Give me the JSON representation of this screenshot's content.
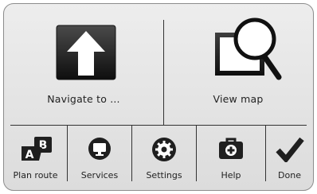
{
  "main_menu": {
    "navigate_label": "Navigate to ...",
    "viewmap_label": "View map"
  },
  "toolbar": {
    "items": [
      {
        "label": "Plan route",
        "icon": "plan-route-icon"
      },
      {
        "label": "Services",
        "icon": "monitor-icon"
      },
      {
        "label": "Settings",
        "icon": "gear-icon"
      },
      {
        "label": "Help",
        "icon": "first-aid-kit-icon"
      },
      {
        "label": "Done",
        "icon": "checkmark-icon"
      }
    ]
  },
  "colors": {
    "background": "#e4e4e4",
    "icon_dark": "#1f1f1f",
    "divider": "#333333"
  }
}
